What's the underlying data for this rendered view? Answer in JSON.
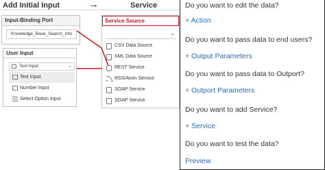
{
  "builder": {
    "col_left_title": "Add Initial Input",
    "col_right_title": "Service",
    "input_binding": {
      "header": "Input-Binding Port",
      "field_value": "Knowledge_Base_Search_Info"
    },
    "service_source": {
      "header": "Service Source",
      "items": [
        {
          "label": "CSV Data Source",
          "icon": "csv-icon"
        },
        {
          "label": "XML Data Source",
          "icon": "xml-icon"
        },
        {
          "label": "REST Service",
          "icon": "rest-icon"
        },
        {
          "label": "RSS/Atom Service",
          "icon": "rss-icon"
        },
        {
          "label": "SOAP Service",
          "icon": "soap-icon"
        },
        {
          "label": "SOAP Service",
          "icon": "soap-icon"
        }
      ]
    },
    "user_input": {
      "header": "User Input",
      "selected": "Text Input",
      "items": [
        {
          "label": "Text Input",
          "icon": "text-input-icon"
        },
        {
          "label": "Number Input",
          "icon": "number-input-icon"
        },
        {
          "label": "Select Option Input",
          "icon": "select-option-icon"
        }
      ]
    },
    "colors": {
      "accent_red": "#d0171c",
      "link_blue": "#2b6cc4"
    }
  },
  "help": {
    "items": [
      {
        "question": "Do you want to edit the data?",
        "action": "+ Action"
      },
      {
        "question": "Do you want to pass data to end users?",
        "action": "+ Output Parameters"
      },
      {
        "question": "Do you want to pass data to Outport?",
        "action": "+ Outport Parameters"
      },
      {
        "question": "Do you want to add Service?",
        "action": "+ Service"
      },
      {
        "question": "Do you want to test the data?",
        "action": "Preview"
      }
    ]
  }
}
